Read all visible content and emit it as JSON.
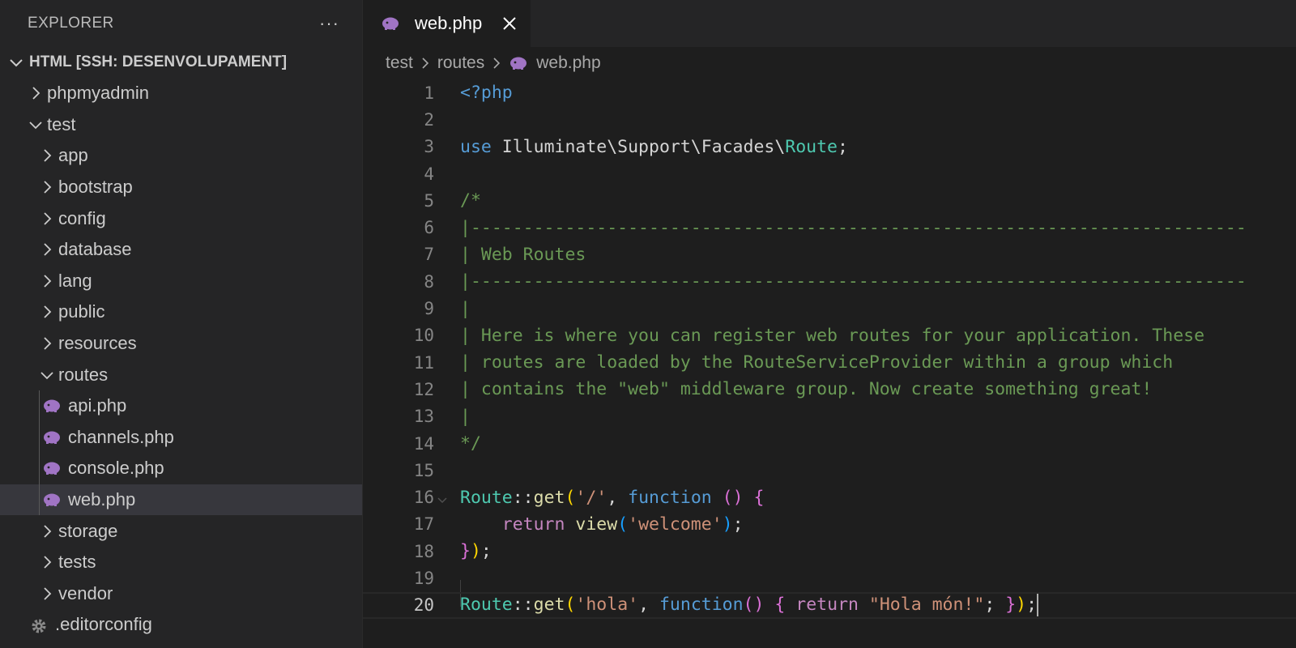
{
  "sidebar": {
    "title": "EXPLORER",
    "more_glyph": "···",
    "section": "HTML [SSH: DESENVOLUPAMENT]",
    "tree": [
      {
        "label": "phpmyadmin",
        "depth": 1,
        "kind": "folder",
        "expanded": false,
        "icon": "chevron-right-icon"
      },
      {
        "label": "test",
        "depth": 1,
        "kind": "folder",
        "expanded": true,
        "icon": "chevron-down-icon"
      },
      {
        "label": "app",
        "depth": 2,
        "kind": "folder",
        "expanded": false,
        "icon": "chevron-right-icon"
      },
      {
        "label": "bootstrap",
        "depth": 2,
        "kind": "folder",
        "expanded": false,
        "icon": "chevron-right-icon"
      },
      {
        "label": "config",
        "depth": 2,
        "kind": "folder",
        "expanded": false,
        "icon": "chevron-right-icon"
      },
      {
        "label": "database",
        "depth": 2,
        "kind": "folder",
        "expanded": false,
        "icon": "chevron-right-icon"
      },
      {
        "label": "lang",
        "depth": 2,
        "kind": "folder",
        "expanded": false,
        "icon": "chevron-right-icon"
      },
      {
        "label": "public",
        "depth": 2,
        "kind": "folder",
        "expanded": false,
        "icon": "chevron-right-icon"
      },
      {
        "label": "resources",
        "depth": 2,
        "kind": "folder",
        "expanded": false,
        "icon": "chevron-right-icon"
      },
      {
        "label": "routes",
        "depth": 2,
        "kind": "folder",
        "expanded": true,
        "icon": "chevron-down-icon"
      },
      {
        "label": "api.php",
        "depth": 3,
        "kind": "file",
        "icon": "php-elephant-icon"
      },
      {
        "label": "channels.php",
        "depth": 3,
        "kind": "file",
        "icon": "php-elephant-icon"
      },
      {
        "label": "console.php",
        "depth": 3,
        "kind": "file",
        "icon": "php-elephant-icon"
      },
      {
        "label": "web.php",
        "depth": 3,
        "kind": "file",
        "icon": "php-elephant-icon",
        "active": true
      },
      {
        "label": "storage",
        "depth": 2,
        "kind": "folder",
        "expanded": false,
        "icon": "chevron-right-icon"
      },
      {
        "label": "tests",
        "depth": 2,
        "kind": "folder",
        "expanded": false,
        "icon": "chevron-right-icon"
      },
      {
        "label": "vendor",
        "depth": 2,
        "kind": "folder",
        "expanded": false,
        "icon": "chevron-right-icon"
      },
      {
        "label": ".editorconfig",
        "depth": 2,
        "kind": "file",
        "icon": "gear-icon"
      }
    ]
  },
  "editor": {
    "tab": {
      "label": "web.php",
      "icon": "php-elephant-icon",
      "close_icon": "close-icon"
    },
    "breadcrumb": [
      "test",
      "routes",
      "web.php"
    ],
    "current_line": 20,
    "lines": [
      [
        {
          "t": "<?php",
          "c": "k"
        }
      ],
      [],
      [
        {
          "t": "use",
          "c": "k"
        },
        {
          "t": " Illuminate\\Support\\Facades\\",
          "c": "t"
        },
        {
          "t": "Route",
          "c": "cls"
        },
        {
          "t": ";",
          "c": "t"
        }
      ],
      [],
      [
        {
          "t": "/*",
          "c": "c"
        }
      ],
      [
        {
          "t": "|--------------------------------------------------------------------------",
          "c": "c"
        }
      ],
      [
        {
          "t": "| Web Routes",
          "c": "c"
        }
      ],
      [
        {
          "t": "|--------------------------------------------------------------------------",
          "c": "c"
        }
      ],
      [
        {
          "t": "|",
          "c": "c"
        }
      ],
      [
        {
          "t": "| Here is where you can register web routes for your application. These",
          "c": "c"
        }
      ],
      [
        {
          "t": "| routes are loaded by the RouteServiceProvider within a group which",
          "c": "c"
        }
      ],
      [
        {
          "t": "| contains the \"web\" middleware group. Now create something great!",
          "c": "c"
        }
      ],
      [
        {
          "t": "|",
          "c": "c"
        }
      ],
      [
        {
          "t": "*/",
          "c": "c"
        }
      ],
      [],
      [
        {
          "t": "Route",
          "c": "cls"
        },
        {
          "t": "::",
          "c": "t"
        },
        {
          "t": "get",
          "c": "fn"
        },
        {
          "t": "(",
          "c": "b1"
        },
        {
          "t": "'/'",
          "c": "s"
        },
        {
          "t": ", ",
          "c": "t"
        },
        {
          "t": "function",
          "c": "k"
        },
        {
          "t": " ",
          "c": "t"
        },
        {
          "t": "()",
          "c": "b2"
        },
        {
          "t": " ",
          "c": "t"
        },
        {
          "t": "{",
          "c": "b2"
        }
      ],
      [
        {
          "t": "    ",
          "c": "t"
        },
        {
          "t": "return",
          "c": "kc"
        },
        {
          "t": " ",
          "c": "t"
        },
        {
          "t": "view",
          "c": "fn"
        },
        {
          "t": "(",
          "c": "b3"
        },
        {
          "t": "'welcome'",
          "c": "s"
        },
        {
          "t": ")",
          "c": "b3"
        },
        {
          "t": ";",
          "c": "t"
        }
      ],
      [
        {
          "t": "}",
          "c": "b2"
        },
        {
          "t": ")",
          "c": "b1"
        },
        {
          "t": ";",
          "c": "t"
        }
      ],
      [],
      [
        {
          "t": "Route",
          "c": "cls"
        },
        {
          "t": "::",
          "c": "t"
        },
        {
          "t": "get",
          "c": "fn"
        },
        {
          "t": "(",
          "c": "b1"
        },
        {
          "t": "'hola'",
          "c": "s"
        },
        {
          "t": ", ",
          "c": "t"
        },
        {
          "t": "function",
          "c": "k"
        },
        {
          "t": "()",
          "c": "b2"
        },
        {
          "t": " ",
          "c": "t"
        },
        {
          "t": "{",
          "c": "b2"
        },
        {
          "t": " ",
          "c": "t"
        },
        {
          "t": "return",
          "c": "kc"
        },
        {
          "t": " ",
          "c": "t"
        },
        {
          "t": "\"Hola món!\"",
          "c": "s"
        },
        {
          "t": "; ",
          "c": "t"
        },
        {
          "t": "}",
          "c": "b2"
        },
        {
          "t": ")",
          "c": "b1"
        },
        {
          "t": ";",
          "c": "t"
        }
      ]
    ]
  }
}
